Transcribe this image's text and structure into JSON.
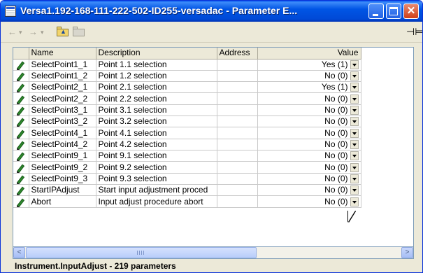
{
  "window": {
    "title": "Versa1.192-168-111-222-502-ID255-versadac - Parameter E...",
    "minimize_label": "_",
    "maximize_label": "□",
    "close_label": "✕"
  },
  "toolbar": {
    "back_label": "←",
    "back_menu_label": "▾",
    "forward_label": "→",
    "forward_menu_label": "▾",
    "pin_label": "⊣⊨"
  },
  "table": {
    "columns": [
      "Name",
      "Description",
      "Address",
      "Value"
    ],
    "rows": [
      {
        "name": "SelectPoint1_1",
        "description": "Point 1.1 selection",
        "address": "",
        "value": "Yes (1)"
      },
      {
        "name": "SelectPoint1_2",
        "description": "Point 1.2 selection",
        "address": "",
        "value": "No (0)"
      },
      {
        "name": "SelectPoint2_1",
        "description": "Point 2.1 selection",
        "address": "",
        "value": "Yes (1)"
      },
      {
        "name": "SelectPoint2_2",
        "description": "Point 2.2 selection",
        "address": "",
        "value": "No (0)"
      },
      {
        "name": "SelectPoint3_1",
        "description": "Point 3.1 selection",
        "address": "",
        "value": "No (0)"
      },
      {
        "name": "SelectPoint3_2",
        "description": "Point 3.2 selection",
        "address": "",
        "value": "No (0)"
      },
      {
        "name": "SelectPoint4_1",
        "description": "Point 4.1 selection",
        "address": "",
        "value": "No (0)"
      },
      {
        "name": "SelectPoint4_2",
        "description": "Point 4.2 selection",
        "address": "",
        "value": "No (0)"
      },
      {
        "name": "SelectPoint9_1",
        "description": "Point 9.1 selection",
        "address": "",
        "value": "No (0)"
      },
      {
        "name": "SelectPoint9_2",
        "description": "Point 9.2 selection",
        "address": "",
        "value": "No (0)"
      },
      {
        "name": "SelectPoint9_3",
        "description": "Point 9.3 selection",
        "address": "",
        "value": "No (0)"
      },
      {
        "name": "StartIPAdjust",
        "description": "Start input adjustment proced",
        "address": "",
        "value": "No (0)"
      },
      {
        "name": "Abort",
        "description": "Input adjust procedure abort",
        "address": "",
        "value": "No (0)"
      }
    ]
  },
  "scrollbar": {
    "left_arrow": "<",
    "right_arrow": ">"
  },
  "status": {
    "text": "Instrument.InputAdjust  -  219 parameters"
  },
  "colors": {
    "titlebar": "#0055e5",
    "close_button": "#cf3f18",
    "edit_icon": "#2e8b2e"
  }
}
